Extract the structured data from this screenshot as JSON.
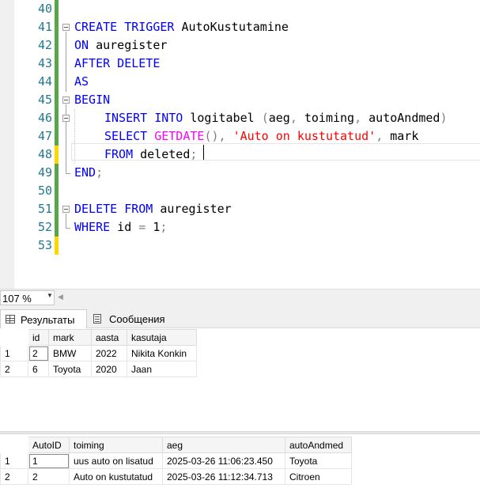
{
  "editor": {
    "line_numbers": [
      "40",
      "41",
      "42",
      "43",
      "44",
      "45",
      "46",
      "47",
      "48",
      "49",
      "50",
      "51",
      "52",
      "53"
    ],
    "lines": {
      "l41_kw": "CREATE TRIGGER",
      "l41_name": " AutoKustutamine",
      "l42_kw": "ON",
      "l42_rest": " auregister",
      "l43_kw": "AFTER DELETE",
      "l44_kw": "AS",
      "l45_kw": "BEGIN",
      "l46_kw": "INSERT INTO",
      "l46_rest": " logitabel ",
      "l46_paren_open": "(",
      "l46_cols": "aeg",
      "l46_c1": ", ",
      "l46_col2": "toiming",
      "l46_c2": ", ",
      "l46_col3": "autoAndmed",
      "l46_paren_close": ")",
      "l47_kw": "SELECT",
      "l47_fn": " GETDATE",
      "l47_parens": "()",
      "l47_comma": ", ",
      "l47_str": "'Auto on kustutatud'",
      "l47_comma2": ",",
      "l47_rest": " mark",
      "l48_kw": "FROM",
      "l48_rest": " deleted",
      "l48_semi": ";",
      "l49_kw": "END",
      "l49_semi": ";",
      "l51_kw": "DELETE FROM",
      "l51_rest": " auregister",
      "l52_kw": "WHERE",
      "l52_rest": " id ",
      "l52_eq": "=",
      "l52_val": " 1",
      "l52_semi": ";"
    }
  },
  "zoom": {
    "value": "107 %"
  },
  "tabs": {
    "results_label": "Результаты",
    "messages_label": "Сообщения"
  },
  "grid1": {
    "columns": [
      "id",
      "mark",
      "aasta",
      "kasutaja"
    ],
    "rows": [
      {
        "rn": "1",
        "id": "2",
        "mark": "BMW",
        "aasta": "2022",
        "kasutaja": "Nikita Konkin"
      },
      {
        "rn": "2",
        "id": "6",
        "mark": "Toyota",
        "aasta": "2020",
        "kasutaja": "Jaan"
      }
    ]
  },
  "grid2": {
    "columns": [
      "AutoID",
      "toiming",
      "aeg",
      "autoAndmed"
    ],
    "rows": [
      {
        "rn": "1",
        "AutoID": "1",
        "toiming": "uus auto on lisatud",
        "aeg": "2025-03-26 11:06:23.450",
        "autoAndmed": "Toyota"
      },
      {
        "rn": "2",
        "AutoID": "2",
        "toiming": "Auto on kustutatud",
        "aeg": "2025-03-26 11:12:34.713",
        "autoAndmed": "Citroen"
      }
    ]
  },
  "colors": {
    "keyword": "#0000ff",
    "function": "#ff00ff",
    "string": "#ff0000",
    "operator": "#808080",
    "line_number": "#237893",
    "change_saved": "#57a64a",
    "change_unsaved": "#ffd700"
  }
}
